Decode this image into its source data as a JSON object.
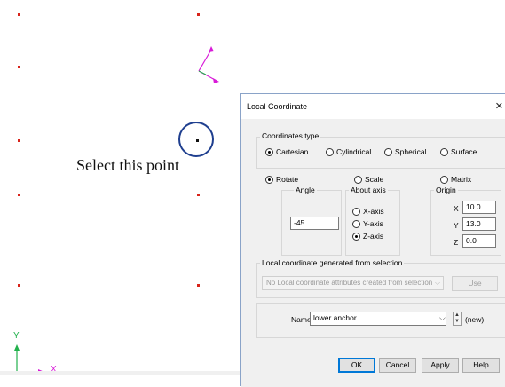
{
  "canvas": {
    "annotation": "Select this point",
    "axis_y_label": "Y",
    "axis_x_label": "X",
    "colors": {
      "point": "#d8231a",
      "axis_green": "#22b14c",
      "axis_magenta": "#d81bd8",
      "highlight": "#1f3f8f"
    }
  },
  "dialog": {
    "title": "Local Coordinate",
    "close_icon": "close-icon",
    "coordinates_type": {
      "label": "Coordinates type",
      "options": [
        "Cartesian",
        "Cylindrical",
        "Spherical",
        "Surface"
      ],
      "selected": "Cartesian"
    },
    "transform": {
      "options": [
        "Rotate",
        "Scale",
        "Matrix"
      ],
      "selected": "Rotate"
    },
    "angle": {
      "label": "Angle",
      "value": "-45"
    },
    "about_axis": {
      "label": "About axis",
      "options": [
        "X-axis",
        "Y-axis",
        "Z-axis"
      ],
      "selected": "Z-axis"
    },
    "origin": {
      "label": "Origin",
      "x_label": "X",
      "x_value": "10.0",
      "y_label": "Y",
      "y_value": "13.0",
      "z_label": "Z",
      "z_value": "0.0"
    },
    "selection": {
      "label": "Local coordinate generated from selection",
      "combo_value": "No Local coordinate attributes created from selection",
      "use_button": "Use"
    },
    "name": {
      "label": "Name",
      "value": "lower anchor",
      "suffix": "(new)"
    },
    "buttons": {
      "ok": "OK",
      "cancel": "Cancel",
      "apply": "Apply",
      "help": "Help"
    }
  }
}
